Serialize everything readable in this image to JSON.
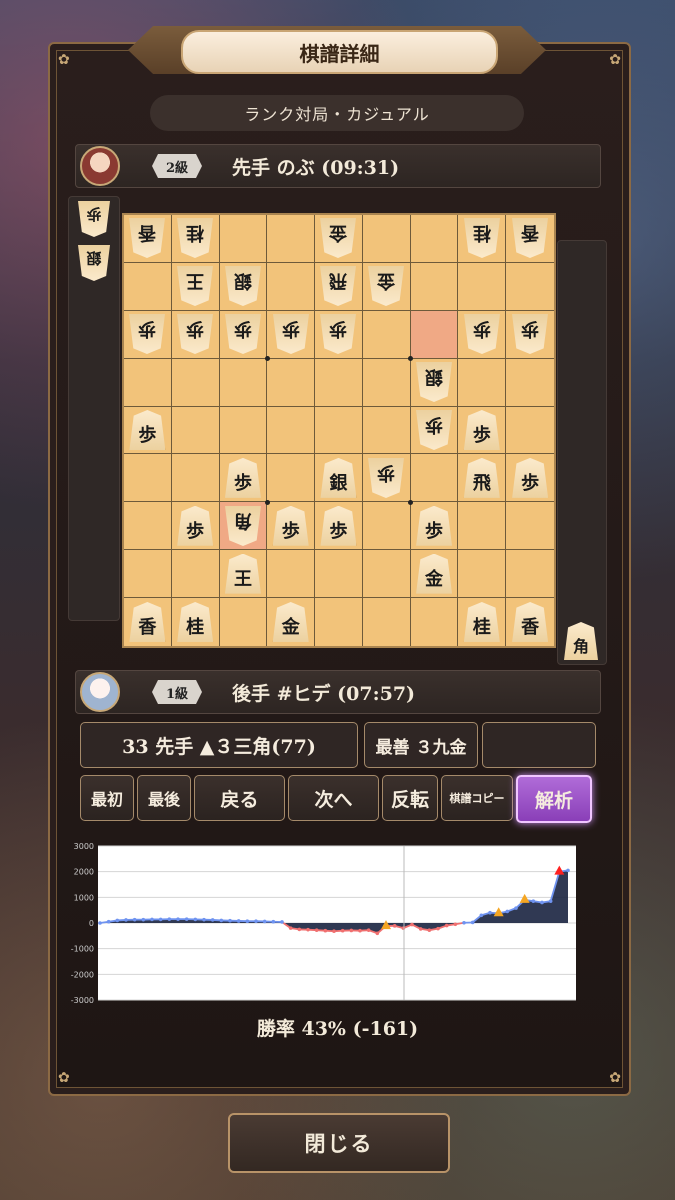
{
  "title": "棋譜詳細",
  "subtitle": "ランク対局・カジュアル",
  "sente": {
    "rank": "2級",
    "label": "先手 のぶ (09:31)"
  },
  "gote": {
    "rank": "1級",
    "label": "後手 #ヒデ (07:57)"
  },
  "gote_hand": [
    "歩",
    "銀"
  ],
  "sente_hand": [
    "角"
  ],
  "board": [
    [
      [
        "香",
        1
      ],
      [
        "桂",
        1
      ],
      "",
      "",
      [
        "金",
        1
      ],
      "",
      "",
      [
        "桂",
        1
      ],
      [
        "香",
        1
      ]
    ],
    [
      "",
      [
        "王",
        1
      ],
      [
        "銀",
        1
      ],
      "",
      [
        "飛",
        1
      ],
      [
        "金",
        1
      ],
      "",
      "",
      ""
    ],
    [
      [
        "歩",
        1
      ],
      [
        "歩",
        1
      ],
      [
        "歩",
        1
      ],
      [
        "歩",
        1
      ],
      [
        "歩",
        1
      ],
      "",
      "",
      [
        "歩",
        1
      ],
      [
        "歩",
        1
      ]
    ],
    [
      "",
      "",
      "",
      "",
      "",
      "",
      [
        "銀",
        1
      ],
      "",
      ""
    ],
    [
      [
        "歩",
        0
      ],
      "",
      "",
      "",
      "",
      "",
      [
        "歩",
        1
      ],
      [
        "歩",
        0
      ],
      ""
    ],
    [
      "",
      "",
      [
        "歩",
        0
      ],
      "",
      [
        "銀",
        0
      ],
      [
        "歩",
        1
      ],
      "",
      [
        "飛",
        0
      ],
      [
        "歩",
        0
      ]
    ],
    [
      "",
      [
        "歩",
        0
      ],
      [
        "角",
        1
      ],
      [
        "歩",
        0
      ],
      [
        "歩",
        0
      ],
      "",
      [
        "歩",
        0
      ],
      "",
      ""
    ],
    [
      "",
      "",
      [
        "王",
        0
      ],
      "",
      "",
      "",
      [
        "金",
        0
      ],
      "",
      ""
    ],
    [
      [
        "香",
        0
      ],
      [
        "桂",
        0
      ],
      "",
      [
        "金",
        0
      ],
      "",
      "",
      "",
      [
        "桂",
        0
      ],
      [
        "香",
        0
      ]
    ]
  ],
  "move": {
    "text": "33 先手 ▲３三角(77)",
    "best": "最善 ３九金",
    "empty": ""
  },
  "buttons": {
    "first": "最初",
    "last": "最後",
    "back": "戻る",
    "next": "次へ",
    "flip": "反転",
    "copy": "棋譜コピー",
    "analyze": "解析"
  },
  "chart_data": {
    "type": "line",
    "ylim": [
      -3000,
      3000
    ],
    "yticks": [
      "3000",
      "2000",
      "1000",
      "0",
      "-1000",
      "-2000",
      "-3000"
    ],
    "values": [
      0,
      50,
      100,
      120,
      130,
      130,
      140,
      140,
      150,
      150,
      150,
      140,
      130,
      120,
      100,
      90,
      80,
      70,
      70,
      60,
      50,
      40,
      -200,
      -250,
      -260,
      -280,
      -300,
      -320,
      -300,
      -290,
      -300,
      -280,
      -400,
      -120,
      -110,
      -200,
      -60,
      -230,
      -280,
      -220,
      -100,
      -50,
      10,
      20,
      300,
      400,
      380,
      450,
      580,
      900,
      850,
      800,
      850,
      2000,
      2050
    ],
    "cursor_index": 33,
    "orange_markers": [
      33,
      46,
      49
    ],
    "red_markers": [
      53
    ]
  },
  "winrate": "勝率 43% (-161)",
  "close": "閉じる",
  "colors": {
    "positive": "#6f93f0",
    "negative": "#f07070",
    "marker": "#f5a623",
    "danger": "#ff2020"
  }
}
